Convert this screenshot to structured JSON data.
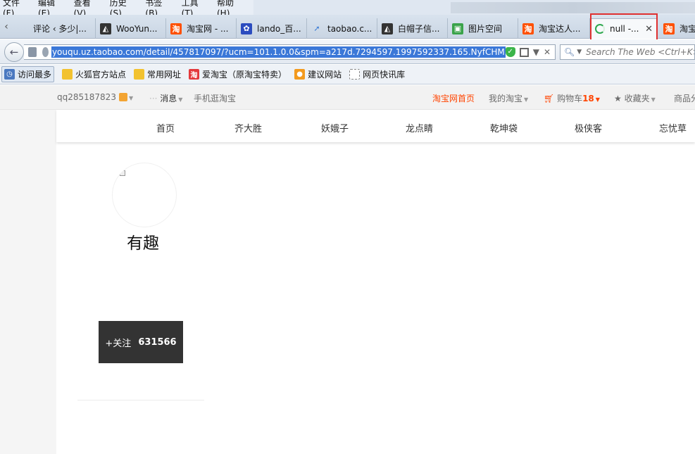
{
  "menubar": {
    "items": [
      "文件(F)",
      "编辑(E)",
      "查看(V)",
      "历史(S)",
      "书签(B)",
      "工具(T)",
      "帮助(H)"
    ]
  },
  "tabs": [
    {
      "label": "评论 ‹ 多少|...",
      "icon": "page-icon",
      "color": "#8899aa"
    },
    {
      "label": "WooYun...",
      "icon": "wooyun-icon",
      "color": "#333333"
    },
    {
      "label": "淘宝网 - ...",
      "icon": "taobao-icon",
      "color": "#ff5000"
    },
    {
      "label": "lando_百...",
      "icon": "baidu-paw-icon",
      "color": "#2b4cbf"
    },
    {
      "label": "taobao.c...",
      "icon": "arrow-icon",
      "color": "#3a7bd5"
    },
    {
      "label": "白帽子信...",
      "icon": "wooyun-icon",
      "color": "#333333"
    },
    {
      "label": "图片空间",
      "icon": "image-icon",
      "color": "#3aa34a"
    },
    {
      "label": "淘宝达人...",
      "icon": "taobao-icon",
      "color": "#ff5000"
    },
    {
      "label": "null -...",
      "icon": "loading-icon",
      "color": "#2fa84f",
      "active": true
    },
    {
      "label": "淘宝",
      "icon": "taobao-icon",
      "color": "#ff5000"
    }
  ],
  "nav": {
    "url": "youqu.uz.taobao.com/detail/457817097/?ucm=101.1.0.0&spm=a217d.7294597.1997592337.165.NyfCHM",
    "search_placeholder": "Search The Web <Ctrl+K>"
  },
  "bookmarks": [
    {
      "label": "访问最多",
      "icon": "most-visited-icon",
      "color": "#4a78c0"
    },
    {
      "label": "火狐官方站点",
      "icon": "folder-icon",
      "color": "#f2c230"
    },
    {
      "label": "常用网址",
      "icon": "folder-icon",
      "color": "#f2c230"
    },
    {
      "label": "爱淘宝（原淘宝特卖）",
      "icon": "taobao-icon",
      "color": "#e4393c"
    },
    {
      "label": "建议网站",
      "icon": "lightbulb-icon",
      "color": "#f39a1e"
    },
    {
      "label": "网页快讯库",
      "icon": "webslice-icon",
      "color": "#ffffff"
    }
  ],
  "taobao_topbar": {
    "username": "qq285187823",
    "messages": "消息",
    "mobile": "手机逛淘宝",
    "home": "淘宝网首页",
    "my_taobao": "我的淘宝",
    "cart": "购物车",
    "cart_count": "18",
    "favorites": "收藏夹",
    "goods": "商品分"
  },
  "site_nav": [
    "首页",
    "齐大胜",
    "妖娥子",
    "龙点睛",
    "乾坤袋",
    "极侠客",
    "忘忧草"
  ],
  "shop": {
    "name": "有趣",
    "follow_label": "+关注",
    "follow_count": "631566"
  },
  "colors": {
    "taobao_orange": "#ff4400",
    "highlight_red": "#e03030",
    "url_selection": "#3b78d8",
    "follow_bg": "#333333"
  }
}
